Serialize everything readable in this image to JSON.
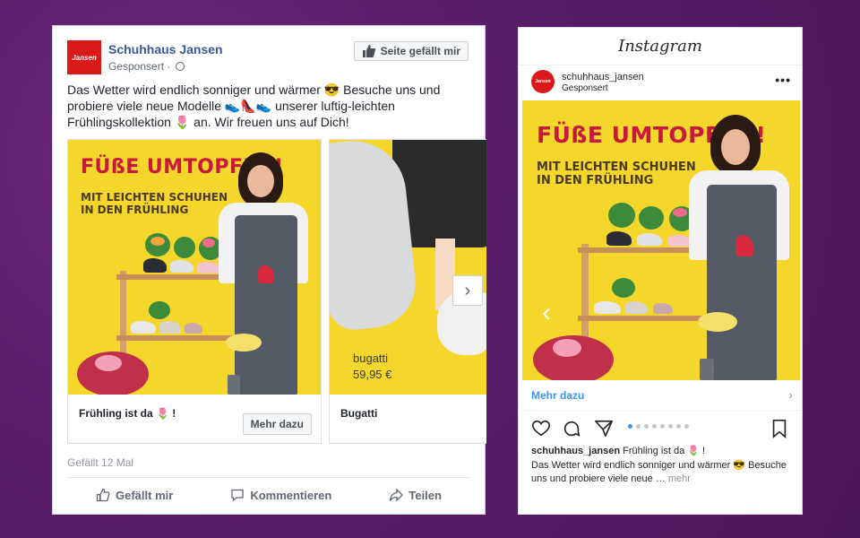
{
  "facebook": {
    "page_name": "Schuhhaus Jansen",
    "logo_text": "Jansen",
    "sponsored": "Gesponsert ·",
    "like_page_label": "Seite gefällt mir",
    "post_text": "Das Wetter wird endlich sonniger und wärmer 😎 Besuche uns und probiere viele neue Modelle 👟👠👟 unserer luftig-leichten Frühlingskollektion 🌷 an. Wir freuen uns auf Dich!",
    "carousel": [
      {
        "headline": "FÜßE UMTOPFEN!",
        "subline_1": "MIT LEICHTEN SCHUHEN",
        "subline_2": "IN DEN FRÜHLING",
        "title": "Frühling ist da 🌷 !",
        "button": "Mehr dazu"
      },
      {
        "brand": "bugatti",
        "price": "59,95 €",
        "title": "Bugatti"
      }
    ],
    "next_arrow": "›",
    "likes": "Gefällt 12 Mal",
    "actions": {
      "like": "Gefällt mir",
      "comment": "Kommentieren",
      "share": "Teilen"
    }
  },
  "instagram": {
    "wordmark": "Instagram",
    "username": "schuhhaus_jansen",
    "sponsored": "Gesponsert",
    "avatar_text": "Jansen",
    "menu": "•••",
    "headline": "FÜßE UMTOPFEN!",
    "subline_1": "MIT LEICHTEN SCHUHEN",
    "subline_2": "IN DEN FRÜHLING",
    "prev_arrow": "‹",
    "more_label": "Mehr dazu",
    "more_chevron": "›",
    "carousel_pages": 8,
    "carousel_active": 1,
    "caption_user": "schuhhaus_jansen",
    "caption": "Frühling ist da 🌷 !",
    "body_text": "Das Wetter wird endlich sonniger und wärmer 😎 Besuche uns und probiere viele neue …",
    "body_more": "mehr"
  },
  "colors": {
    "background": "#5e1f6e",
    "ad_yellow": "#f5d62a",
    "headline_red": "#c8183d",
    "fb_blue": "#385898",
    "ig_blue": "#3897f0",
    "brand_red": "#d9191a"
  },
  "icons": [
    "globe-icon",
    "thumbs-up-icon",
    "comment-icon",
    "share-icon",
    "chevron-right-icon",
    "heart-icon",
    "ig-comment-icon",
    "direct-icon",
    "bookmark-icon"
  ]
}
